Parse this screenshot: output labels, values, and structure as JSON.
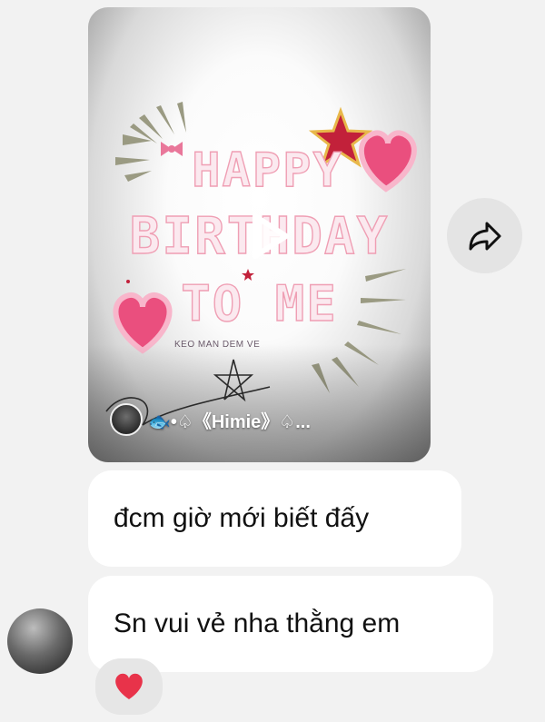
{
  "video": {
    "line1": "HAPPY",
    "line2": "BIRTHDAY",
    "line3": "TO ME",
    "caption": "KEO MAN DEM VE",
    "channel_name": "🐟•♤《Himie》♤...",
    "signature": "Himie",
    "play_icon": "play-icon"
  },
  "share": {
    "icon": "share-arrow-icon"
  },
  "messages": [
    {
      "text": "đcm giờ mới biết đấy"
    },
    {
      "text": "Sn vui vẻ nha thằng em"
    }
  ],
  "reaction": {
    "emoji": "❤️"
  },
  "colors": {
    "background": "#f2f2f2",
    "bubble": "#ffffff",
    "heart": "#e8334a",
    "star": "#c2213a",
    "text_outline": "#ef9fb4"
  }
}
